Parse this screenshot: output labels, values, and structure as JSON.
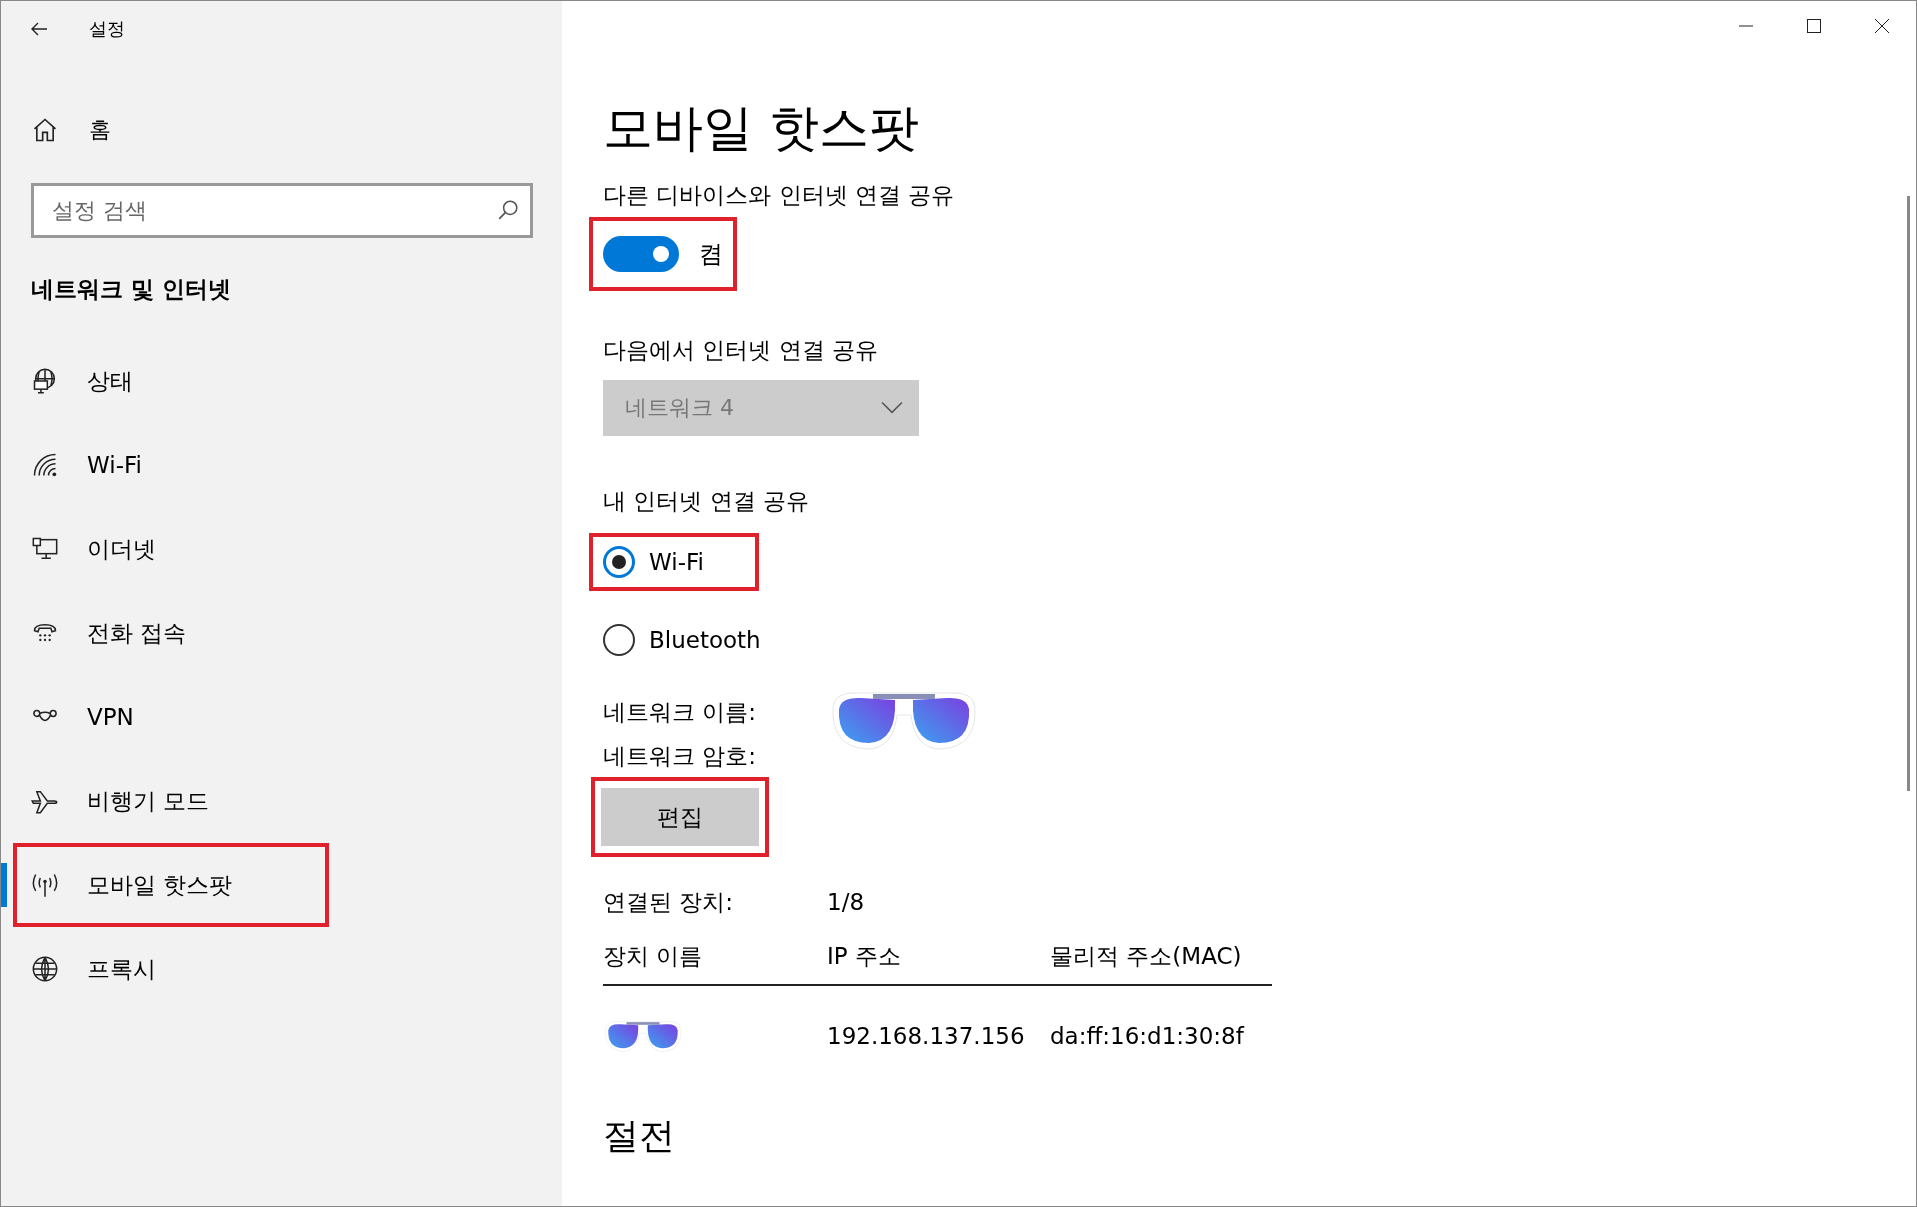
{
  "window": {
    "title": "설정"
  },
  "sidebar": {
    "home": "홈",
    "search": {
      "placeholder": "설정 검색"
    },
    "section": "네트워크 및 인터넷",
    "items": [
      {
        "label": "상태",
        "selected": false,
        "highlighted": false
      },
      {
        "label": "Wi-Fi",
        "selected": false,
        "highlighted": false
      },
      {
        "label": "이더넷",
        "selected": false,
        "highlighted": false
      },
      {
        "label": "전화 접속",
        "selected": false,
        "highlighted": false
      },
      {
        "label": "VPN",
        "selected": false,
        "highlighted": false
      },
      {
        "label": "비행기 모드",
        "selected": false,
        "highlighted": false
      },
      {
        "label": "모바일 핫스팟",
        "selected": true,
        "highlighted": true
      },
      {
        "label": "프록시",
        "selected": false,
        "highlighted": false
      }
    ]
  },
  "main": {
    "title": "모바일 핫스팟",
    "share_toggle": {
      "label": "다른 디바이스와 인터넷 연결 공유",
      "on": true,
      "state_text": "켬",
      "highlighted": true
    },
    "share_from": {
      "label": "다음에서 인터넷 연결 공유",
      "value": "네트워크 4",
      "disabled": true
    },
    "share_over": {
      "label": "내 인터넷 연결 공유",
      "options": [
        {
          "label": "Wi-Fi",
          "selected": true,
          "highlighted": true
        },
        {
          "label": "Bluetooth",
          "selected": false,
          "highlighted": false
        }
      ]
    },
    "network_name": {
      "label": "네트워크 이름:",
      "redacted": true
    },
    "network_password": {
      "label": "네트워크 암호:",
      "redacted": true
    },
    "edit_button": {
      "label": "편집",
      "highlighted": true
    },
    "connected": {
      "label": "연결된 장치:",
      "value": "1/8"
    },
    "devices": {
      "columns": [
        "장치 이름",
        "IP 주소",
        "물리적 주소(MAC)"
      ],
      "rows": [
        {
          "name_redacted": true,
          "ip": "192.168.137.156",
          "mac": "da:ff:16:d1:30:8f"
        }
      ]
    },
    "power_title": "절전"
  }
}
